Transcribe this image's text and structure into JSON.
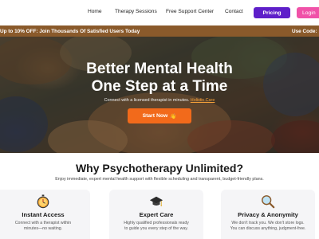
{
  "nav": {
    "links": [
      "Home",
      "Therapy Sessions",
      "Free Support Center",
      "Contact"
    ],
    "pricing_label": "Pricing",
    "login_label": "Login",
    "colors": {
      "pricing_bg": "#5e1fc9",
      "login_bg": "#f052a8"
    }
  },
  "promo": {
    "left_text": "Up to 10% OFF: Join Thousands Of Satisfied Users Today",
    "right_text": "Use Code:"
  },
  "hero": {
    "title_line1": "Better Mental Health",
    "title_line2": "One Step at a Time",
    "subtitle": "Connect with a licensed therapist in minutes.",
    "subtitle_link": "Holistic Care",
    "cta_label": "Start Now",
    "cta_icon": "waving-hand-icon",
    "colors": {
      "cta_bg": "#f26a1b",
      "link": "#f7a23a"
    }
  },
  "why": {
    "title": "Why Psychotherapy Unlimited?",
    "subtitle": "Enjoy immediate, expert mental health support with flexible scheduling and transparent, budget-friendly plans."
  },
  "features": [
    {
      "icon": "stopwatch-icon",
      "title": "Instant Access",
      "desc_line1": "Connect with a therapist within",
      "desc_line2": "minutes—no waiting."
    },
    {
      "icon": "graduation-cap-icon",
      "title": "Expert Care",
      "desc_line1": "Highly qualified professionals ready",
      "desc_line2": "to guide you every step of the way."
    },
    {
      "icon": "magnifier-icon",
      "title": "Privacy & Anonymity",
      "desc_line1": "We don't track you. We don't store logs.",
      "desc_line2": "You can discuss anything, judgment-free."
    }
  ]
}
